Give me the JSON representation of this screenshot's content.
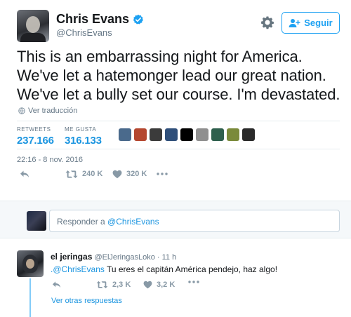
{
  "author": {
    "name": "Chris Evans",
    "handle": "@ChrisEvans"
  },
  "follow_button": {
    "label": "Seguir"
  },
  "tweet": {
    "text": "This is an embarrassing night for America. We've let a hatemonger lead our great nation. We've let a bully set our course. I'm devastated.",
    "translate_label": "Ver traducción",
    "timestamp": "22:16 - 8 nov. 2016"
  },
  "stats": {
    "retweets_label": "RETWEETS",
    "retweets_value": "237.166",
    "likes_label": "ME GUSTA",
    "likes_value": "316.133"
  },
  "actions": {
    "retweet_count": "240 K",
    "like_count": "320 K"
  },
  "liker_avatars": [
    "#4a6a8c",
    "#b4472f",
    "#3b3b3b",
    "#2f4f7a",
    "#000000",
    "#8f8f8f",
    "#2e5f4d",
    "#7a8a3a",
    "#2a2a2a"
  ],
  "reply_box": {
    "prefix": "Responder a ",
    "mention": "@ChrisEvans"
  },
  "reply": {
    "name": "el jeringas",
    "handle": "@ElJeringasLoko",
    "time": "11 h",
    "mention": ".@ChrisEvans",
    "text": " Tu eres el capitán América pendejo, haz algo!",
    "retweet_count": "2,3 K",
    "like_count": "3,2 K",
    "more_label": "Ver otras respuestas"
  },
  "colors": {
    "accent": "#1da1f2",
    "link": "#1b95e0",
    "muted": "#657786"
  }
}
